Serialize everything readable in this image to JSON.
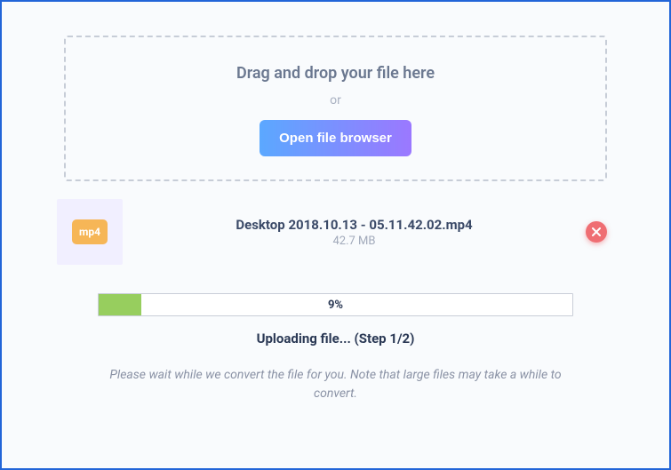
{
  "dropZone": {
    "title": "Drag and drop your file here",
    "or": "or",
    "buttonLabel": "Open file browser"
  },
  "file": {
    "badge": "mp4",
    "name": "Desktop 2018.10.13 - 05.11.42.02.mp4",
    "size": "42.7 MB"
  },
  "progress": {
    "percent": 9,
    "label": "9%",
    "fillWidth": "9%"
  },
  "status": "Uploading file... (Step 1/2)",
  "note": "Please wait while we convert the file for you. Note that large files may take a while to convert."
}
